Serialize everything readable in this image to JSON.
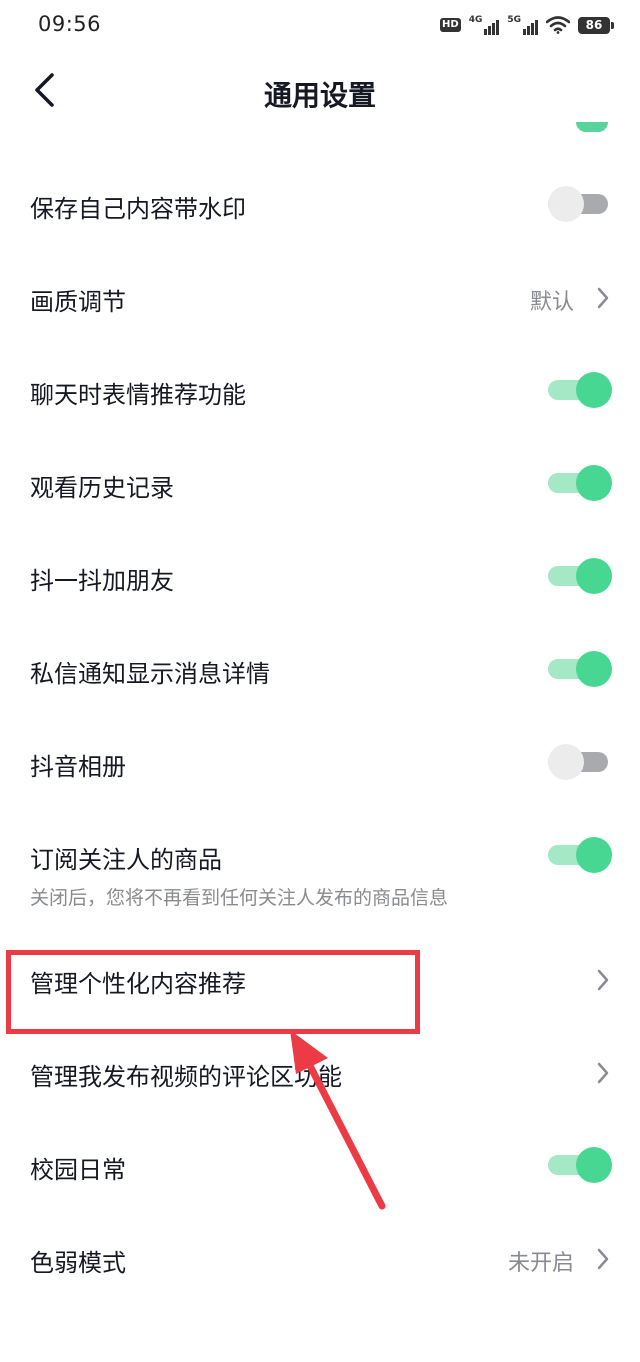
{
  "status_bar": {
    "time": "09:56",
    "hd_label": "HD",
    "net1": "4G",
    "net2": "5G",
    "battery": "86",
    "icons": [
      "hd-icon",
      "signal-4g-icon",
      "signal-5g-icon",
      "wifi-icon",
      "battery-icon"
    ]
  },
  "nav": {
    "title": "通用设置",
    "back_icon": "chevron-left-icon"
  },
  "settings": [
    {
      "label": "保存自己内容带水印",
      "control": "toggle",
      "on": false
    },
    {
      "label": "画质调节",
      "control": "link",
      "value": "默认"
    },
    {
      "label": "聊天时表情推荐功能",
      "control": "toggle",
      "on": true
    },
    {
      "label": "观看历史记录",
      "control": "toggle",
      "on": true
    },
    {
      "label": "抖一抖加朋友",
      "control": "toggle",
      "on": true
    },
    {
      "label": "私信通知显示消息详情",
      "control": "toggle",
      "on": true
    },
    {
      "label": "抖音相册",
      "control": "toggle",
      "on": false
    },
    {
      "label": "订阅关注人的商品",
      "control": "toggle",
      "on": true,
      "subtitle": "关闭后，您将不再看到任何关注人发布的商品信息"
    },
    {
      "label": "管理个性化内容推荐",
      "control": "link",
      "value": ""
    },
    {
      "label": "管理我发布视频的评论区功能",
      "control": "link",
      "value": ""
    },
    {
      "label": "校园日常",
      "control": "toggle",
      "on": true
    },
    {
      "label": "色弱模式",
      "control": "link",
      "value": "未开启"
    }
  ],
  "colors": {
    "toggle_on_knob": "#48d693",
    "toggle_on_track": "#a4e8c5",
    "toggle_off_knob": "#ececec",
    "toggle_off_track": "#a9aaad",
    "annotation_red": "#ec3b44"
  }
}
